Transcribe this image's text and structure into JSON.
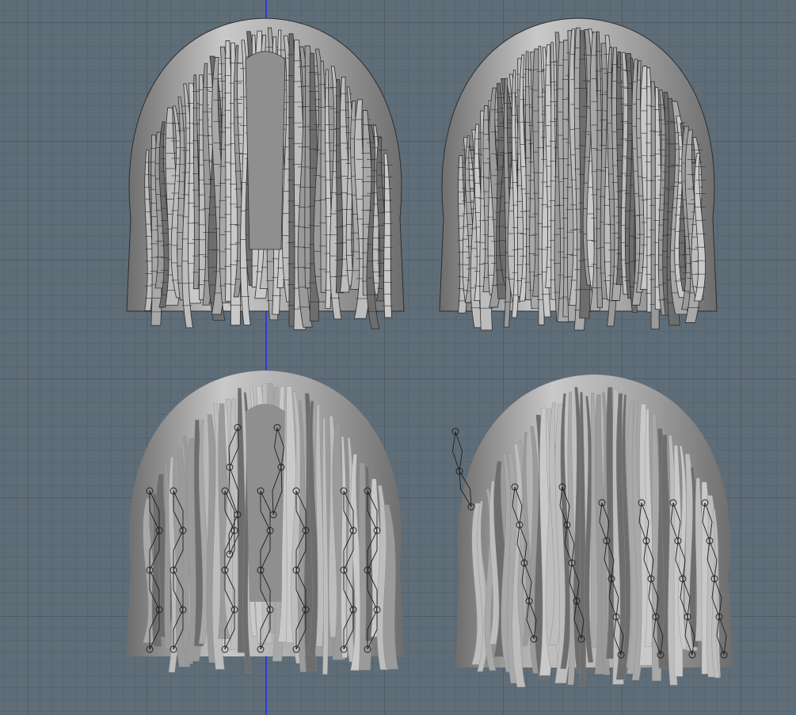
{
  "viewport": {
    "background": "#5f6d78",
    "grid_major": "#4f5c66",
    "grid_minor": "#57656f",
    "axis_color": "#2b3fd0"
  },
  "views": [
    {
      "id": "front-wireframe",
      "shading": "wireframe",
      "facing": "front"
    },
    {
      "id": "back-wireframe",
      "shading": "wireframe",
      "facing": "back"
    },
    {
      "id": "front-shaded-with-bones",
      "shading": "solid",
      "facing": "front"
    },
    {
      "id": "side-shaded-with-bones",
      "shading": "solid",
      "facing": "three-quarter"
    }
  ],
  "colors": {
    "hair_light": "#c9c9c9",
    "hair_mid": "#a8a8a8",
    "hair_dark": "#6d6d6d",
    "wire": "#2e2e2e",
    "bone": "#1e1e1e"
  }
}
